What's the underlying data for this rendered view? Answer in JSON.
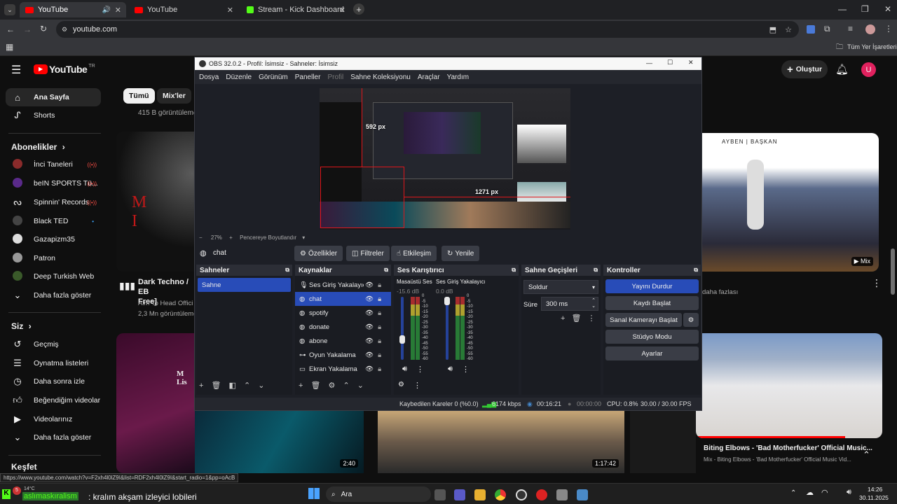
{
  "browser": {
    "tabs": [
      {
        "title": "YouTube",
        "active": true,
        "audio": true
      },
      {
        "title": "YouTube",
        "active": false
      },
      {
        "title": "Stream - Kick Dashboard",
        "active": false
      }
    ],
    "url": "youtube.com",
    "bookmarks_all": "Tüm Yer İşaretleri",
    "status_url": "https://www.youtube.com/watch?v=F2xh4l0lZ9I&list=RDF2xh4l0lZ9I&start_radio=1&pp=oAcB"
  },
  "youtube": {
    "logo": "YouTube",
    "logo_country": "TR",
    "create": "Oluştur",
    "avatar": "U",
    "chips": [
      "Tümü",
      "Mix'ler"
    ],
    "nav": [
      {
        "label": "Ana Sayfa",
        "icon": "home-icon"
      },
      {
        "label": "Shorts",
        "icon": "shorts-icon"
      }
    ],
    "subs_header": "Abonelikler",
    "subs": [
      {
        "label": "İnci Taneleri",
        "live": true
      },
      {
        "label": "beIN SPORTS Tü...",
        "live": true
      },
      {
        "label": "Spinnin' Records",
        "live": true
      },
      {
        "label": "Black TED",
        "live": false,
        "dot": true
      },
      {
        "label": "Gazapizm35",
        "live": false
      },
      {
        "label": "Patron",
        "live": false
      },
      {
        "label": "Deep Turkish Web",
        "live": false
      }
    ],
    "show_more": "Daha fazla göster",
    "you_header": "Siz",
    "you": [
      {
        "label": "Geçmiş",
        "icon": "history-icon"
      },
      {
        "label": "Oynatma listeleri",
        "icon": "playlist-icon"
      },
      {
        "label": "Daha sonra izle",
        "icon": "clock-icon"
      },
      {
        "label": "Beğendiğim videolar",
        "icon": "like-icon"
      },
      {
        "label": "Videolarınız",
        "icon": "video-icon"
      }
    ],
    "show_more2": "Daha fazla göster",
    "explore": "Keşfet",
    "videos": {
      "top_views": "415 B görüntüleme",
      "dark_title": "Dark Techno / EB",
      "dark_title2": "Free]",
      "dark_channel": "Aim To Head Offici",
      "dark_views": "2,3 Mn görüntüleme",
      "mix_badge": "Mix",
      "ayben_title": "AYBEN  |  BAŞKAN",
      "more_text": "daha fazlası",
      "biting_title": "Biting Elbows - 'Bad Motherfucker' Official Music...",
      "biting_sub": "Mix - Biting Elbows - 'Bad Motherfucker' Official Music Vid...",
      "d1": "2:40",
      "d2": "1:17:42",
      "m_text": "M I",
      "mlis": "M Lis"
    }
  },
  "obs": {
    "title": "OBS 32.0.2 - Profil: İsimsiz - Sahneler: İsimsiz",
    "menu": [
      "Dosya",
      "Düzenle",
      "Görünüm",
      "Paneller",
      "Profil",
      "Sahne Koleksiyonu",
      "Araçlar",
      "Yardım"
    ],
    "preview": {
      "zoom": "27%",
      "fit": "Pencereye Boyutlandır",
      "px1": "592 px",
      "px2": "1271 px"
    },
    "selected_source": "chat",
    "toolbar": [
      "Özellikler",
      "Filtreler",
      "Etkileşim",
      "Yenile"
    ],
    "scenes_title": "Sahneler",
    "scenes": [
      "Sahne"
    ],
    "sources_title": "Kaynaklar",
    "sources": [
      {
        "name": "Ses Giriş Yakalayıcısı",
        "icon": "mic-icon"
      },
      {
        "name": "chat",
        "icon": "browser-icon",
        "selected": true
      },
      {
        "name": "spotify",
        "icon": "browser-icon"
      },
      {
        "name": "donate",
        "icon": "browser-icon"
      },
      {
        "name": "abone",
        "icon": "browser-icon"
      },
      {
        "name": "Oyun Yakalama",
        "icon": "gamepad-icon"
      },
      {
        "name": "Ekran Yakalama",
        "icon": "monitor-icon"
      }
    ],
    "mixer_title": "Ses Karıştırıcı",
    "mixer": [
      {
        "name": "Masaüstü Ses",
        "db": "-15.6 dB",
        "level": 0.3
      },
      {
        "name": "Ses Giriş Yakalayıcı",
        "db": "0.0 dB",
        "level": 1.0
      }
    ],
    "mixer_ticks": [
      "0",
      "-5",
      "-10",
      "-15",
      "-20",
      "-25",
      "-30",
      "-35",
      "-40",
      "-45",
      "-50",
      "-55",
      "-60"
    ],
    "transitions_title": "Sahne Geçişleri",
    "transition": "Soldur",
    "duration_label": "Süre",
    "duration": "300 ms",
    "controls_title": "Kontroller",
    "controls": [
      "Yayını Durdur",
      "Kaydı Başlat",
      "Sanal Kamerayı Başlat",
      "Stüdyo Modu",
      "Ayarlar"
    ],
    "status": {
      "dropped": "Kaybedilen Kareler 0 (%0.0)",
      "kbps": "6174 kbps",
      "live_time": "00:16:21",
      "rec_time": "00:00:00",
      "cpu": "CPU: 0.8%",
      "fps": "30.00 / 30.00 FPS"
    }
  },
  "taskbar": {
    "temp": "14°C",
    "notif": "5",
    "ticker_user": "aslımaskıralism",
    "ticker_text": ": kralım akşam izleyici lobileri",
    "search": "Ara",
    "time": "14:26",
    "date": "30.11.2025"
  },
  "colors": {
    "yt_red": "#ff0000",
    "obs_blue": "#284cb8",
    "accent_kick": "#53fc18"
  }
}
